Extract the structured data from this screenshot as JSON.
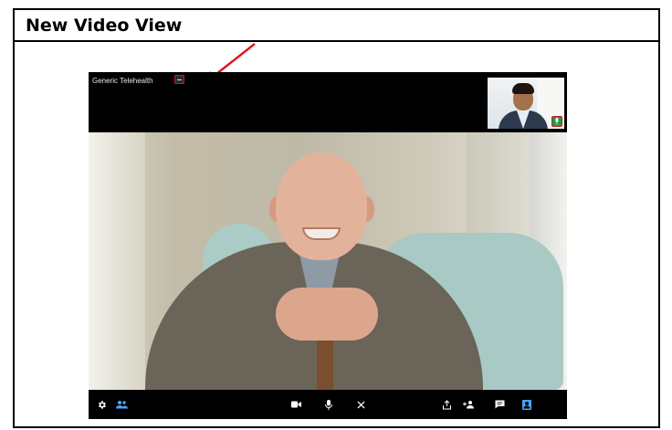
{
  "frame": {
    "title": "New Video View"
  },
  "video": {
    "app_title": "Generic Telehealth",
    "minimize_icon": "minimize-icon",
    "self_view_icon": "mic-icon",
    "accent_color": "#c0202a",
    "active_color": "#4aa3ff",
    "toolbar_left": [
      {
        "name": "settings",
        "icon": "gear-icon"
      },
      {
        "name": "participants",
        "icon": "people-icon",
        "active": true
      }
    ],
    "toolbar_center": [
      {
        "name": "camera",
        "icon": "camera-icon"
      },
      {
        "name": "microphone",
        "icon": "mic-icon"
      },
      {
        "name": "end-call",
        "icon": "close-icon"
      }
    ],
    "toolbar_right": [
      {
        "name": "share",
        "icon": "share-icon"
      },
      {
        "name": "add-participant",
        "icon": "add-person-icon"
      },
      {
        "name": "chat",
        "icon": "chat-icon"
      },
      {
        "name": "profile",
        "icon": "contact-icon",
        "active": true
      }
    ]
  }
}
